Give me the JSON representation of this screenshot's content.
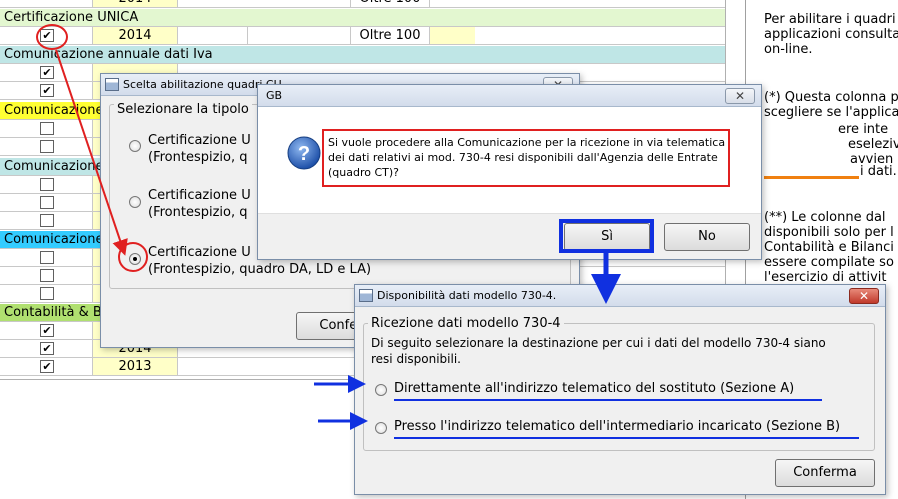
{
  "background_table": {
    "sections": [
      {
        "label": "Certificazione UNICA",
        "color": "#e3f7d0"
      },
      {
        "label": "Comunicazione annuale dati Iva",
        "color": "#bfe6e6"
      },
      {
        "label": "Comunicazione",
        "color": "#ffff33"
      },
      {
        "label": "Comunicazione",
        "color": "#bfe6e6"
      },
      {
        "label": "Comunicazione",
        "color": "#33ccff"
      },
      {
        "label": "Contabilità & B",
        "color": "#b0e070"
      }
    ],
    "year_2014": "2014",
    "year_2013": "2013",
    "oltre_100": "Oltre 100",
    "check_mark": "✔"
  },
  "note_panel": {
    "lines": [
      "Per abilitare i quadri",
      "applicazioni consulta",
      "on-line.",
      "(*) Questa colonna p",
      "scegliere se l'applica",
      "ere inte",
      "eseleziv",
      "avvien",
      "i dati.",
      "(**) Le colonne dal",
      "disponibili solo per l",
      "Contabilità e Bilanci",
      "essere compilate so",
      "l'esercizio di attivit"
    ]
  },
  "dialog_scelta": {
    "title": "Scelta abilitazione quadri CU",
    "group_label": "Selezionare la tipolo",
    "options": [
      {
        "line1": "Certificazione U",
        "line2": "(Frontespizio, q"
      },
      {
        "line1": "Certificazione U",
        "line2": "(Frontespizio, q"
      },
      {
        "line1": "Certificazione U",
        "line2": "(Frontespizio, quadro DA, LD e LA)"
      }
    ],
    "confirm_label": "Confer"
  },
  "dialog_gb": {
    "title": "GB",
    "message": "Si vuole procedere alla Comunicazione per la ricezione in via telematica dei dati relativi ai mod. 730-4 resi disponibili dall'Agenzia delle Entrate (quadro CT)?",
    "yes_label": "Sì",
    "no_label": "No",
    "icon": "question-icon"
  },
  "dialog_disponibilita": {
    "title": "Disponibilità dati modello 730-4.",
    "group_label": "Ricezione dati modello 730-4",
    "instruction": "Di seguito selezionare la destinazione per cui i dati del modello 730-4 siano resi disponibili.",
    "option_a": "Direttamente all'indirizzo telematico del sostituto (Sezione A)",
    "option_b": "Presso l'indirizzo telematico dell'intermediario incaricato (Sezione B)",
    "confirm_label": "Conferma"
  }
}
